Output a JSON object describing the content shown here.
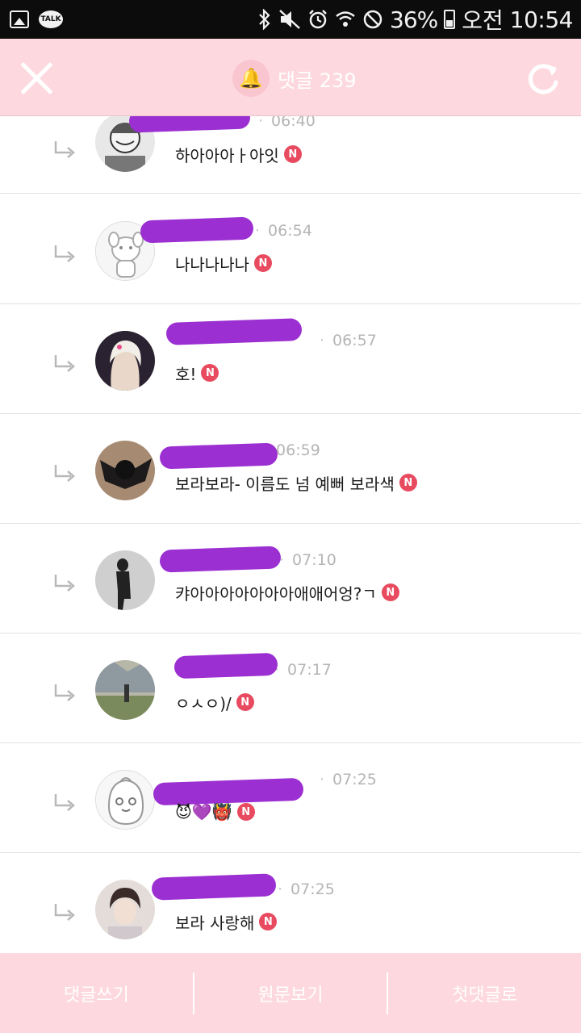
{
  "status_bar": {
    "battery": "36%",
    "ampm": "오전",
    "time": "10:54",
    "talk_icon": "TALK",
    "icons": [
      "gallery-icon",
      "talk-icon",
      "bluetooth-icon",
      "mute-icon",
      "alarm-icon",
      "wifi-icon",
      "blocked-icon",
      "battery-icon"
    ]
  },
  "header": {
    "title": "댓글 239",
    "bell": "🔔"
  },
  "comments": [
    {
      "time": "06:40",
      "text": "하아아아ㅏ아잇",
      "badge": "N"
    },
    {
      "time": "06:54",
      "text": "나나나나나",
      "badge": "N"
    },
    {
      "time": "06:57",
      "text": "호!",
      "badge": "N"
    },
    {
      "time": "06:59",
      "text": "보라보라- 이름도 넘 예뻐 보라색",
      "badge": "N"
    },
    {
      "time": "07:10",
      "text": "캬아아아아아아아애애어엉?ㄱ",
      "badge": "N"
    },
    {
      "time": "07:17",
      "text": "ㅇㅅㅇ)/",
      "badge": "N"
    },
    {
      "time": "07:25",
      "text": "😈💜👹",
      "badge": "N"
    },
    {
      "time": "07:25",
      "text": "보라 사랑해",
      "badge": "N"
    }
  ],
  "bottom_bar": {
    "write": "댓글쓰기",
    "original": "원문보기",
    "first": "첫댓글로"
  },
  "colors": {
    "header_bg": "#fdd9df",
    "badge": "#e84a5f",
    "redact": "#9b2fd1"
  }
}
